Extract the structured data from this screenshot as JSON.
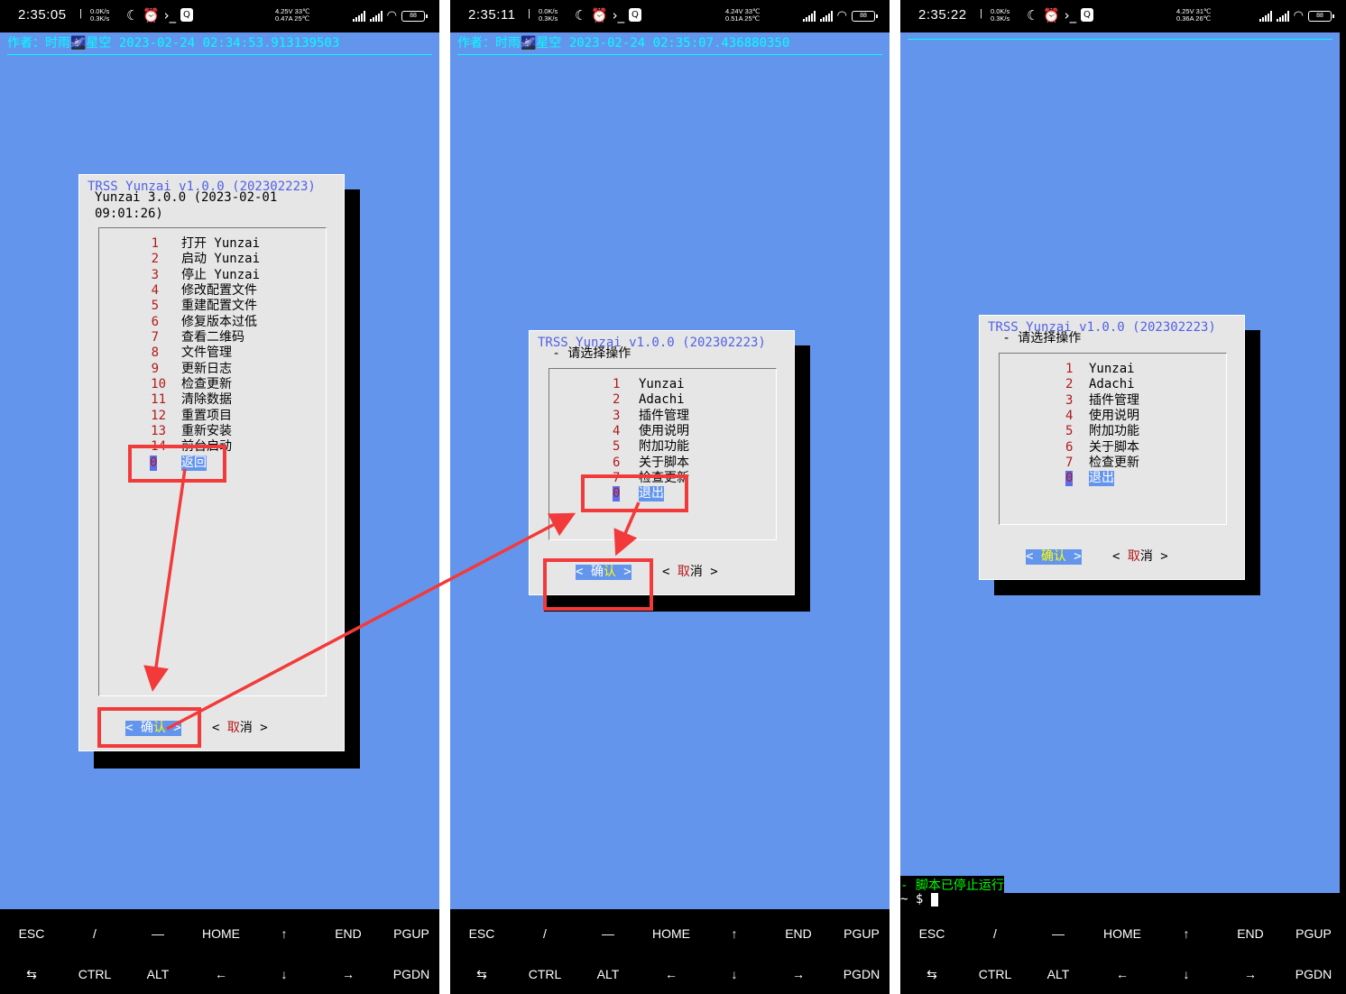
{
  "panels": [
    {
      "status": {
        "time": "2:35:05",
        "sep": "|",
        "net_up": "0.0K/s",
        "net_down": "0.3K/s",
        "bat_v": "4.25V 33℃",
        "bat_a": "0.47A 25℃",
        "battery": "88"
      },
      "header": "作者：时雨🌌星空 2023-02-24 02:34:53.913139503",
      "dialog_title": "TRSS Yunzai v1.0.0 (202302223)",
      "dialog_subtitle": "Yunzai 3.0.0 (2023-02-01\n09:01:26)",
      "items": [
        {
          "num": "1",
          "label": "打开 Yunzai"
        },
        {
          "num": "2",
          "label": "启动 Yunzai"
        },
        {
          "num": "3",
          "label": "停止 Yunzai"
        },
        {
          "num": "4",
          "label": "修改配置文件"
        },
        {
          "num": "5",
          "label": "重建配置文件"
        },
        {
          "num": "6",
          "label": "修复版本过低"
        },
        {
          "num": "7",
          "label": "查看二维码"
        },
        {
          "num": "8",
          "label": "文件管理"
        },
        {
          "num": "9",
          "label": "更新日志"
        },
        {
          "num": "10",
          "label": "检查更新"
        },
        {
          "num": "11",
          "label": "清除数据"
        },
        {
          "num": "12",
          "label": "重置项目"
        },
        {
          "num": "13",
          "label": "重新安装"
        },
        {
          "num": "14",
          "label": "前台启动"
        },
        {
          "num": "0",
          "label": "返回"
        }
      ],
      "ok_button": {
        "pre": "< 确",
        "hot": "认",
        "post": " >"
      },
      "cancel_button": {
        "pre": "< ",
        "hot": "取",
        "post": "消 >"
      }
    },
    {
      "status": {
        "time": "2:35:11",
        "sep": "|",
        "net_up": "0.0K/s",
        "net_down": "0.3K/s",
        "bat_v": "4.24V 33℃",
        "bat_a": "0.51A 25℃",
        "battery": "88"
      },
      "header": "作者：时雨🌌星空 2023-02-24 02:35:07.436880350",
      "dialog_title": "TRSS Yunzai v1.0.0 (202302223)",
      "dialog_subtitle": " - 请选择操作",
      "items": [
        {
          "num": "1",
          "label": "Yunzai"
        },
        {
          "num": "2",
          "label": "Adachi"
        },
        {
          "num": "3",
          "label": "插件管理"
        },
        {
          "num": "4",
          "label": "使用说明"
        },
        {
          "num": "5",
          "label": "附加功能"
        },
        {
          "num": "6",
          "label": "关于脚本"
        },
        {
          "num": "7",
          "label": "检查更新"
        },
        {
          "num": "0",
          "label": "退出"
        }
      ],
      "ok_button": {
        "pre": "< 确",
        "hot": "认",
        "post": " >"
      },
      "cancel_button": {
        "pre": "< ",
        "hot": "取",
        "post": "消 >"
      }
    },
    {
      "status": {
        "time": "2:35:22",
        "sep": "|",
        "net_up": "0.0K/s",
        "net_down": "0.3K/s",
        "bat_v": "4.25V 31℃",
        "bat_a": "0.36A 26℃",
        "battery": "88"
      },
      "header": "",
      "dialog_title": "TRSS Yunzai v1.0.0 (202302223)",
      "dialog_subtitle": " - 请选择操作",
      "items": [
        {
          "num": "1",
          "label": "Yunzai"
        },
        {
          "num": "2",
          "label": "Adachi"
        },
        {
          "num": "3",
          "label": "插件管理"
        },
        {
          "num": "4",
          "label": "使用说明"
        },
        {
          "num": "5",
          "label": "附加功能"
        },
        {
          "num": "6",
          "label": "关于脚本"
        },
        {
          "num": "7",
          "label": "检查更新"
        },
        {
          "num": "0",
          "label": "退出"
        }
      ],
      "ok_button": {
        "pre": "< ",
        "hot": "确认",
        "post": " >"
      },
      "cancel_button": {
        "pre": "< ",
        "hot": "取",
        "post": "消 >"
      },
      "terminal": {
        "line1": "- 脚本已停止运行",
        "line2": "~ $ "
      }
    }
  ],
  "extra_keys": {
    "row1": [
      "ESC",
      "/",
      "—",
      "HOME",
      "↑",
      "END",
      "PGUP"
    ],
    "row2": [
      "⇆",
      "CTRL",
      "ALT",
      "←",
      "↓",
      "→",
      "PGDN"
    ]
  },
  "colors": {
    "screen_bg": "#6495ed",
    "dialog_bg": "#e6e6e6",
    "title": "#4f61e8",
    "number": "#b21a1a",
    "header_cyan": "#00ffff",
    "annotation_red": "#f23a3a",
    "terminal_green": "#00ff00"
  }
}
